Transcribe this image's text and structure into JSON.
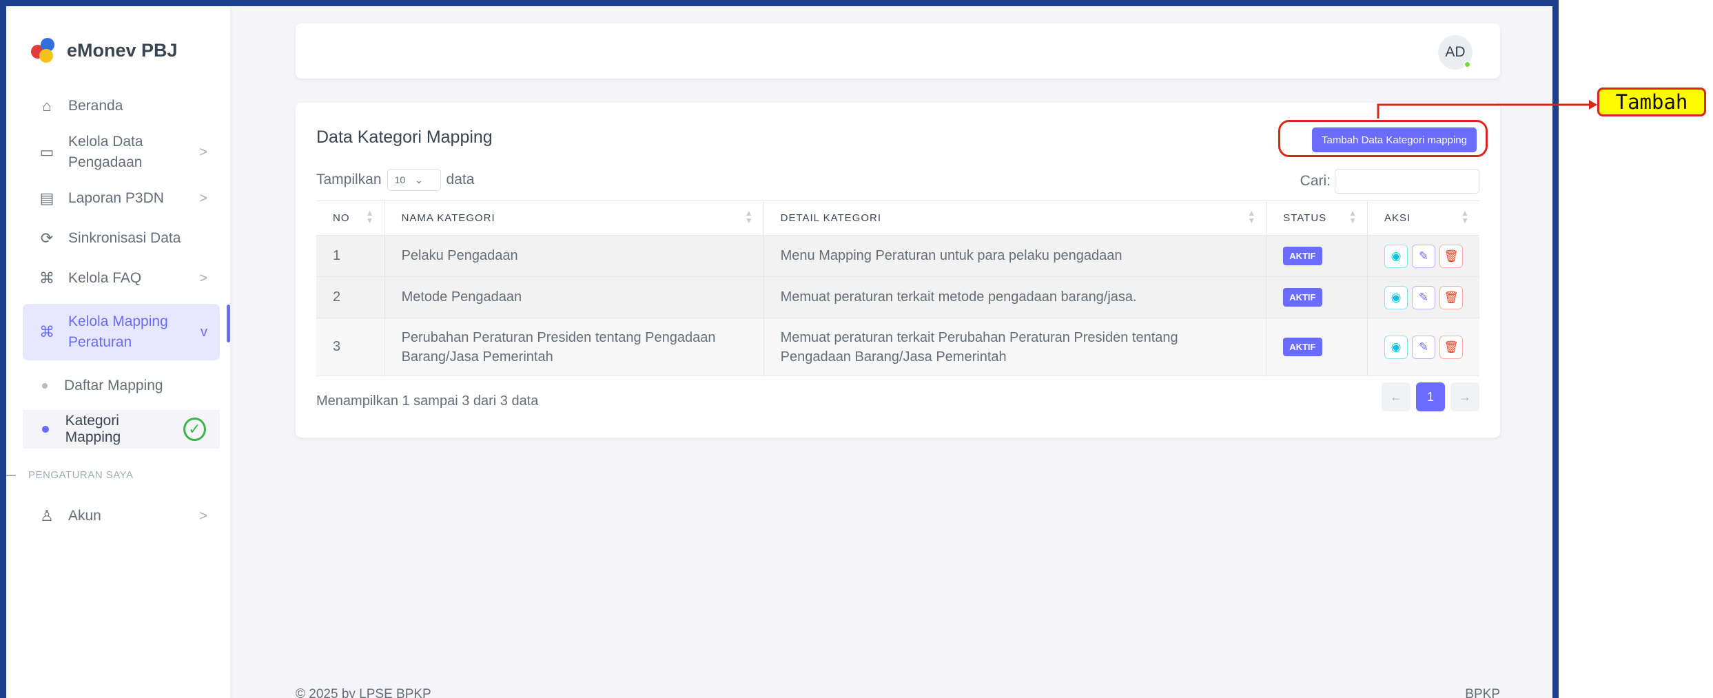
{
  "brand": {
    "title": "eMonev PBJ"
  },
  "sidebar": {
    "items": [
      {
        "label": "Beranda",
        "icon": "home-icon",
        "chevron": ""
      },
      {
        "label": "Kelola Data Pengadaan",
        "icon": "folder-icon",
        "chevron": ">"
      },
      {
        "label": "Laporan P3DN",
        "icon": "report-icon",
        "chevron": ">"
      },
      {
        "label": "Sinkronisasi Data",
        "icon": "sync-icon",
        "chevron": ""
      },
      {
        "label": "Kelola FAQ",
        "icon": "command-icon",
        "chevron": ">"
      },
      {
        "label": "Kelola Mapping Peraturan",
        "icon": "command-icon",
        "chevron": "v"
      }
    ],
    "subitems": [
      {
        "label": "Daftar Mapping"
      },
      {
        "label": "Kategori Mapping"
      }
    ],
    "section_header": "PENGATURAN SAYA",
    "account": {
      "label": "Akun",
      "icon": "user-icon",
      "chevron": ">"
    }
  },
  "navbar": {
    "avatar_initials": "AD"
  },
  "card": {
    "title": "Data Kategori Mapping",
    "add_button": "Tambah Data Kategori mapping",
    "length_prefix": "Tampilkan",
    "length_value": "10",
    "length_suffix": "data",
    "search_label": "Cari:",
    "columns": [
      "NO",
      "NAMA KATEGORI",
      "DETAIL KATEGORI",
      "STATUS",
      "AKSI"
    ],
    "rows": [
      {
        "no": "1",
        "nama": "Pelaku Pengadaan",
        "detail": "Menu Mapping Peraturan untuk para pelaku pengadaan",
        "status": "AKTIF"
      },
      {
        "no": "2",
        "nama": "Metode Pengadaan",
        "detail": "Memuat peraturan terkait metode pengadaan barang/jasa.",
        "status": "AKTIF"
      },
      {
        "no": "3",
        "nama": "Perubahan Peraturan Presiden tentang Pengadaan Barang/Jasa Pemerintah",
        "detail": "Memuat peraturan terkait Perubahan Peraturan Presiden tentang Pengadaan Barang/Jasa Pemerintah",
        "status": "AKTIF"
      }
    ],
    "info": "Menampilkan 1 sampai 3 dari 3 data",
    "pagination": {
      "prev": "←",
      "current": "1",
      "next": "→"
    }
  },
  "footer": {
    "left": "© 2025 by LPSE BPKP",
    "right": "BPKP"
  },
  "annotation": {
    "label": "Tambah"
  },
  "colors": {
    "accent": "#696cff",
    "frame": "#1b3f8b",
    "annotation_border": "#d9261c",
    "annotation_fill": "#fffb00"
  }
}
